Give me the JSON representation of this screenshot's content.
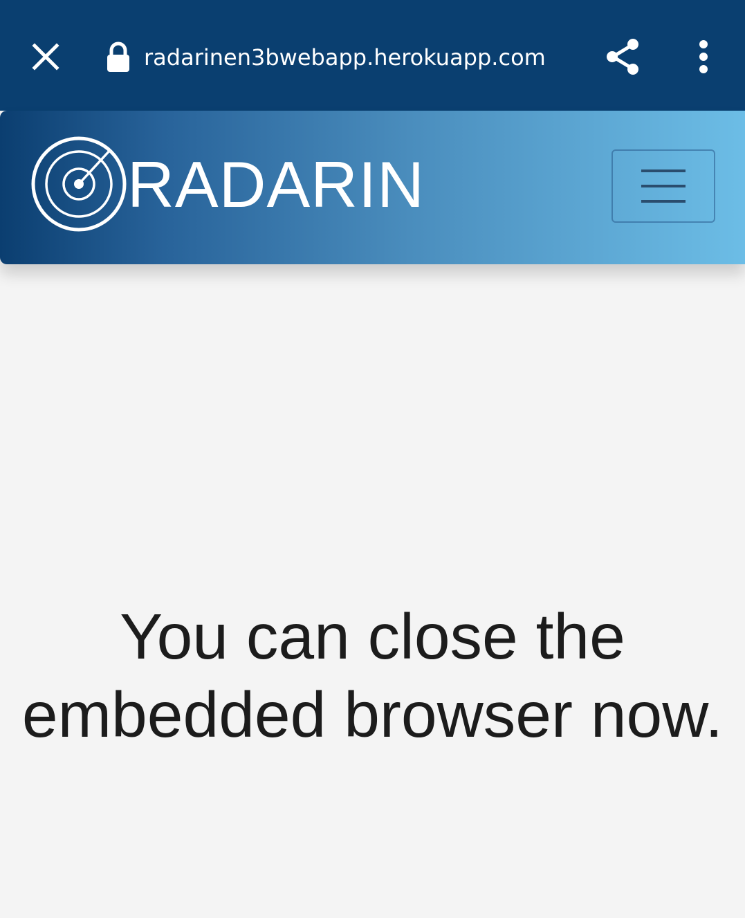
{
  "browser_bar": {
    "url": "radarinen3bwebapp.herokuapp.com",
    "close_icon": "close-icon",
    "lock_icon": "lock-icon",
    "share_icon": "share-icon",
    "more_icon": "more-vertical-icon",
    "background_color": "#0a3f70"
  },
  "site_header": {
    "brand": "RADARIN",
    "logo_icon": "radar-icon",
    "menu_icon": "hamburger-menu-icon",
    "gradient_start": "#0b3e70",
    "gradient_end": "#6cbde6"
  },
  "main": {
    "message_line1": "You can close the",
    "message_line2": "embedded browser now."
  }
}
